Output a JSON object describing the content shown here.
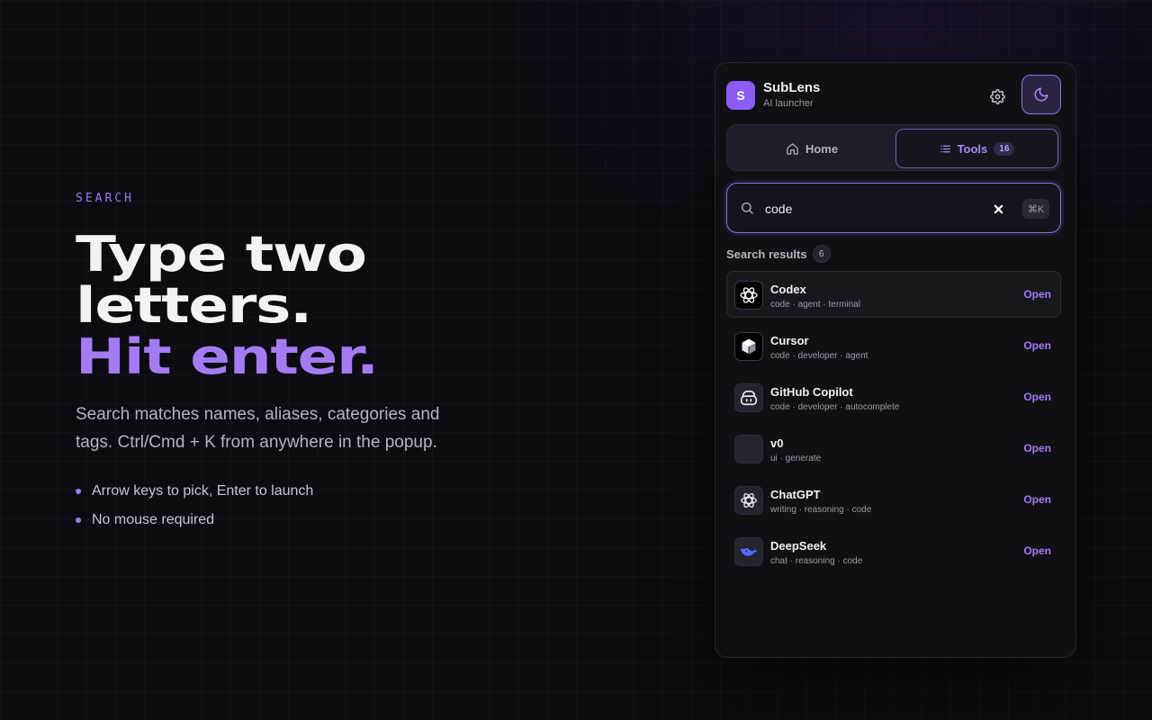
{
  "hero": {
    "eyebrow": "SEARCH",
    "headline_line1": "Type two",
    "headline_line2": "letters.",
    "headline_line3": "Hit enter.",
    "description": "Search matches names, aliases, categories and tags. Ctrl/Cmd + K from anywhere in the popup.",
    "bullets": [
      "Arrow keys to pick, Enter to launch",
      "No mouse required"
    ]
  },
  "popup": {
    "logo_letter": "S",
    "app_name": "SubLens",
    "app_subtitle": "AI launcher",
    "icons": {
      "settings": "gear-icon",
      "theme": "moon-icon"
    },
    "tabs": {
      "home_label": "Home",
      "tools_label": "Tools",
      "tools_count": "16",
      "active": "tools"
    },
    "search": {
      "value": "code",
      "shortcut": "⌘K"
    },
    "results": {
      "title": "Search results",
      "count": "6",
      "items": [
        {
          "name": "Codex",
          "tags": "code · agent · terminal",
          "action": "Open",
          "icon": "openai-icon"
        },
        {
          "name": "Cursor",
          "tags": "code · developer · agent",
          "action": "Open",
          "icon": "cube-icon"
        },
        {
          "name": "GitHub Copilot",
          "tags": "code · developer · autocomplete",
          "action": "Open",
          "icon": "copilot-icon"
        },
        {
          "name": "v0",
          "tags": "ui · generate",
          "action": "Open",
          "icon": ""
        },
        {
          "name": "ChatGPT",
          "tags": "writing · reasoning · code",
          "action": "Open",
          "icon": "openai-icon"
        },
        {
          "name": "DeepSeek",
          "tags": "chat · reasoning · code",
          "action": "Open",
          "icon": "whale-icon"
        }
      ]
    }
  },
  "colors": {
    "accent": "#a27cf4",
    "background": "#0c0b12",
    "panel": "#0f0f14",
    "deepseek": "#4d6bfe"
  }
}
